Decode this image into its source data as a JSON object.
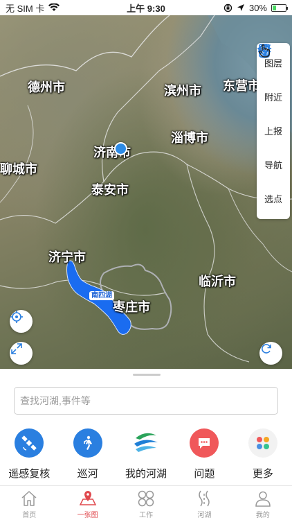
{
  "status_bar": {
    "carrier": "无 SIM 卡",
    "time": "上午 9:30",
    "battery": "30%",
    "battery_level": 0.3
  },
  "map": {
    "cities": [
      {
        "id": "dezhou",
        "name": "德州市"
      },
      {
        "id": "binzhou",
        "name": "滨州市"
      },
      {
        "id": "dongying",
        "name": "东营市"
      },
      {
        "id": "jinan",
        "name": "济南市"
      },
      {
        "id": "zibo",
        "name": "淄博市"
      },
      {
        "id": "liaocheng",
        "name": "聊城市"
      },
      {
        "id": "taian",
        "name": "泰安市"
      },
      {
        "id": "jining",
        "name": "济宁市"
      },
      {
        "id": "linyi",
        "name": "临沂市"
      },
      {
        "id": "zaozhuang",
        "name": "枣庄市"
      }
    ],
    "lake_label": "南四湖",
    "lake_color": "#1a6cf0"
  },
  "toolbox": {
    "layers": "图层",
    "nearby": "附近",
    "report": "上报",
    "navigate": "导航",
    "pick_point": "选点"
  },
  "search": {
    "placeholder": "查找河湖,事件等",
    "value": ""
  },
  "shortcuts": [
    {
      "label": "遥感复核",
      "icon": "satellite-icon",
      "color": "#2a7fe0"
    },
    {
      "label": "巡河",
      "icon": "walking-person-icon",
      "color": "#2a7fe0"
    },
    {
      "label": "我的河湖",
      "icon": "river-logo-icon",
      "color": "#2a9d5a"
    },
    {
      "label": "问题",
      "icon": "chat-bubble-icon",
      "color": "#f0585a"
    },
    {
      "label": "更多",
      "icon": "grid-dots-icon",
      "color": "#f2f2f2"
    }
  ],
  "tabbar": {
    "active": "map",
    "tabs": [
      {
        "id": "home",
        "label": "首页"
      },
      {
        "id": "map",
        "label": "一张图"
      },
      {
        "id": "work",
        "label": "工作"
      },
      {
        "id": "rivers",
        "label": "河湖"
      },
      {
        "id": "mine",
        "label": "我的"
      }
    ],
    "active_color": "#e0484d"
  }
}
